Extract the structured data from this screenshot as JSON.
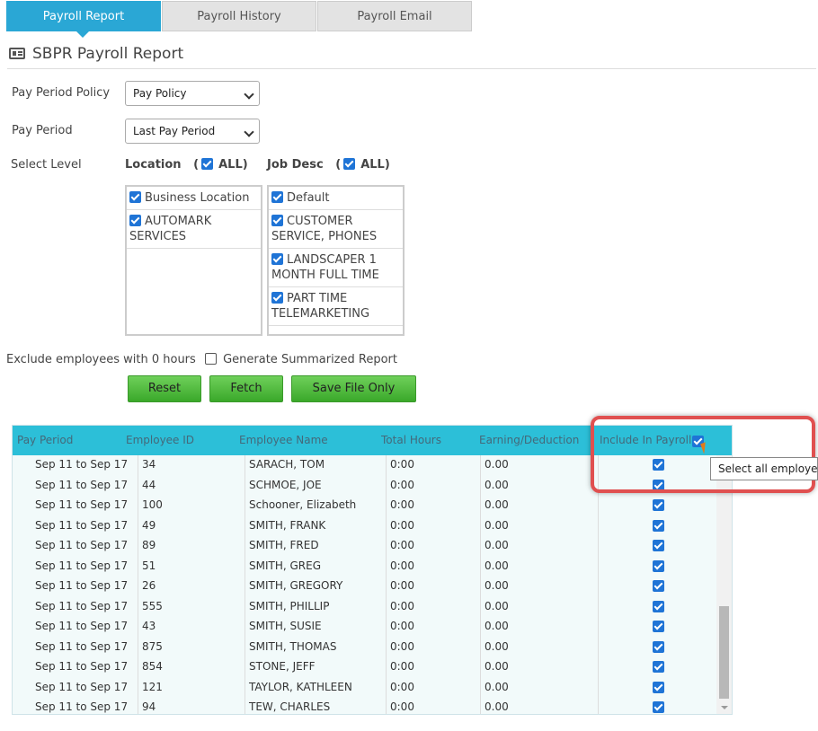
{
  "tabs": [
    {
      "label": "Payroll Report",
      "active": true
    },
    {
      "label": "Payroll History",
      "active": false
    },
    {
      "label": "Payroll Email",
      "active": false
    }
  ],
  "page_title": "SBPR Payroll Report",
  "form": {
    "pay_period_policy_label": "Pay Period Policy",
    "pay_period_policy_value": "Pay Policy",
    "pay_period_label": "Pay Period",
    "pay_period_value": "Last Pay Period",
    "select_level_label": "Select Level",
    "location_label": "Location",
    "location_all_label": "ALL)",
    "location_all_paren": "(",
    "job_desc_label": "Job Desc",
    "job_desc_all_paren": "(",
    "job_desc_all_label": "ALL)",
    "locations": [
      "Business Location",
      "AUTOMARK SERVICES"
    ],
    "job_descs": [
      "Default",
      "CUSTOMER SERVICE, PHONES",
      "LANDSCAPER 1 MONTH FULL TIME",
      "PART TIME TELEMARKETING"
    ],
    "exclude_label": "Exclude employees with 0 hours",
    "summarized_label": "Generate Summarized Report"
  },
  "buttons": {
    "reset": "Reset",
    "fetch": "Fetch",
    "save_file_only": "Save File Only"
  },
  "table": {
    "headers": [
      "Pay Period",
      "Employee ID",
      "Employee Name",
      "Total Hours",
      "Earning/Deduction",
      "Include In Payroll"
    ],
    "rows": [
      [
        "Sep 11 to Sep 17",
        "34",
        "SARACH, TOM",
        "0:00",
        "0.00"
      ],
      [
        "Sep 11 to Sep 17",
        "44",
        "SCHMOE, JOE",
        "0:00",
        "0.00"
      ],
      [
        "Sep 11 to Sep 17",
        "100",
        "Schooner, Elizabeth",
        "0:00",
        "0.00"
      ],
      [
        "Sep 11 to Sep 17",
        "49",
        "SMITH, FRANK",
        "0:00",
        "0.00"
      ],
      [
        "Sep 11 to Sep 17",
        "89",
        "SMITH, FRED",
        "0:00",
        "0.00"
      ],
      [
        "Sep 11 to Sep 17",
        "51",
        "SMITH, GREG",
        "0:00",
        "0.00"
      ],
      [
        "Sep 11 to Sep 17",
        "26",
        "SMITH, GREGORY",
        "0:00",
        "0.00"
      ],
      [
        "Sep 11 to Sep 17",
        "555",
        "SMITH, PHILLIP",
        "0:00",
        "0.00"
      ],
      [
        "Sep 11 to Sep 17",
        "43",
        "SMITH, SUSIE",
        "0:00",
        "0.00"
      ],
      [
        "Sep 11 to Sep 17",
        "875",
        "SMITH, THOMAS",
        "0:00",
        "0.00"
      ],
      [
        "Sep 11 to Sep 17",
        "854",
        "STONE, JEFF",
        "0:00",
        "0.00"
      ],
      [
        "Sep 11 to Sep 17",
        "121",
        "TAYLOR, KATHLEEN",
        "0:00",
        "0.00"
      ],
      [
        "Sep 11 to Sep 17",
        "94",
        "TEW, CHARLES",
        "0:00",
        "0.00"
      ]
    ]
  },
  "tooltip": "Select all employee"
}
